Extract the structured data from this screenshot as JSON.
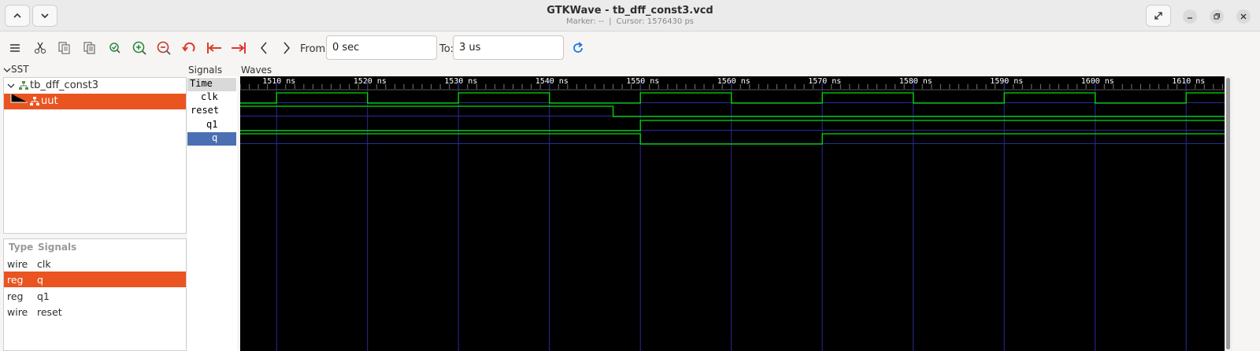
{
  "window": {
    "title": "GTKWave - tb_dff_const3.vcd",
    "marker": "Marker: --",
    "separator": "|",
    "cursor": "Cursor: 1576430 ps"
  },
  "toolbar": {
    "from_label": "From:",
    "from_value": "0 sec",
    "to_label": "To:",
    "to_value": "3 us"
  },
  "sst": {
    "header": "SST",
    "tree": [
      {
        "label": "tb_dff_const3",
        "selected": false
      },
      {
        "label": "uut",
        "selected": true
      }
    ]
  },
  "signal_table": {
    "col_type": "Type",
    "col_signals": "Signals",
    "rows": [
      {
        "type": "wire",
        "name": "clk",
        "selected": false
      },
      {
        "type": "reg",
        "name": "q",
        "selected": true
      },
      {
        "type": "reg",
        "name": "q1",
        "selected": false
      },
      {
        "type": "wire",
        "name": "reset",
        "selected": false
      }
    ]
  },
  "signals_pane": {
    "header": "Signals",
    "rows": [
      "Time",
      "clk",
      "reset",
      "q1",
      "q"
    ]
  },
  "waves": {
    "header": "Waves",
    "time_unit": "ns",
    "ticks": [
      1510,
      1520,
      1530,
      1540,
      1550,
      1560,
      1570,
      1580,
      1590,
      1600,
      1610
    ],
    "traces": {
      "clk": [
        [
          1506,
          0
        ],
        [
          1510,
          1
        ],
        [
          1520,
          0
        ],
        [
          1530,
          1
        ],
        [
          1540,
          0
        ],
        [
          1550,
          1
        ],
        [
          1560,
          0
        ],
        [
          1570,
          1
        ],
        [
          1580,
          0
        ],
        [
          1590,
          1
        ],
        [
          1600,
          0
        ],
        [
          1610,
          1
        ]
      ],
      "reset": [
        [
          1506,
          1
        ],
        [
          1547,
          0
        ]
      ],
      "q1": [
        [
          1506,
          0
        ],
        [
          1550,
          1
        ]
      ],
      "q": [
        [
          1506,
          1
        ],
        [
          1550,
          0
        ],
        [
          1570,
          1
        ]
      ]
    },
    "colors": {
      "background": "#000000",
      "trace": "#00e000",
      "grid": "#2a2a9a",
      "tick_text": "#ffffff"
    }
  }
}
